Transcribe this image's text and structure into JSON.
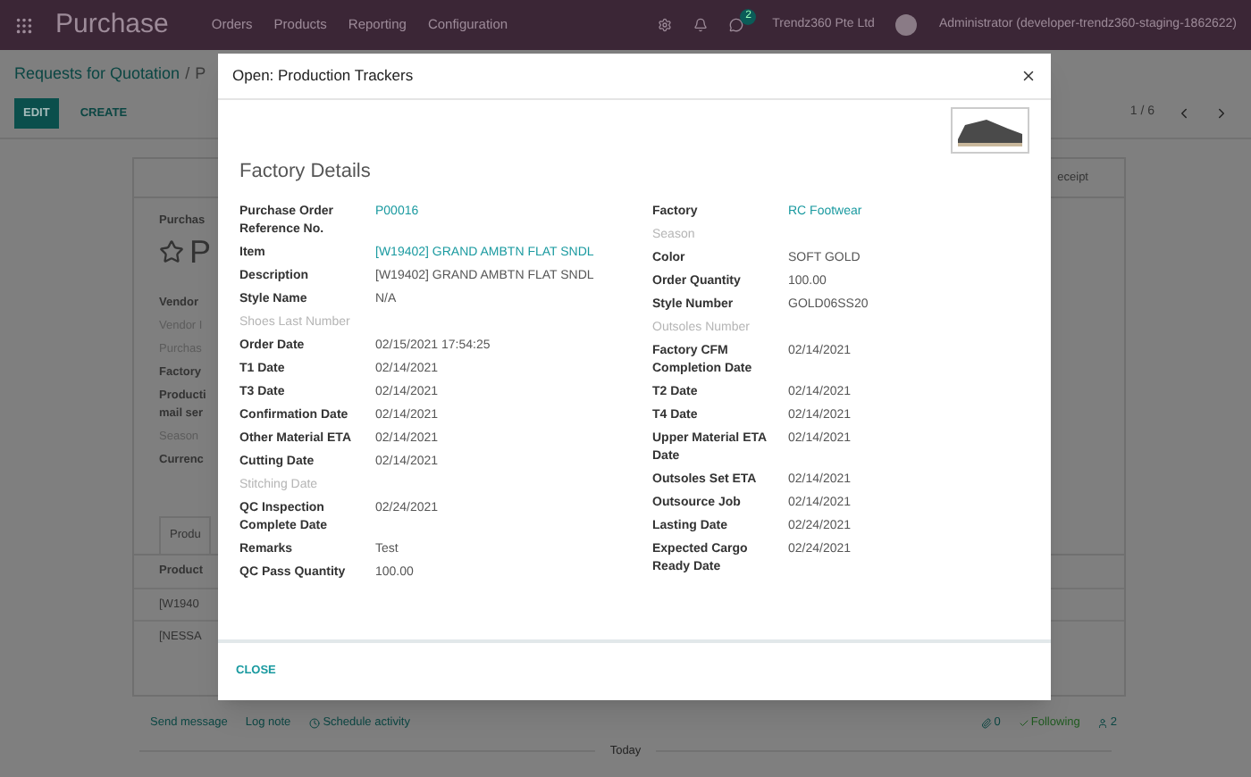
{
  "navbar": {
    "app_title": "Purchase",
    "menu": [
      "Orders",
      "Products",
      "Reporting",
      "Configuration"
    ],
    "chat_badge": "2",
    "company": "Trendz360 Pte Ltd",
    "user": "Administrator (developer-trendz360-staging-1862622)"
  },
  "breadcrumb": {
    "parent": "Requests for Quotation",
    "separator": "/",
    "current": "P"
  },
  "buttons": {
    "edit": "EDIT",
    "create": "CREATE"
  },
  "pager": "1 / 6",
  "sheet": {
    "heading": "Purchas",
    "title": "P",
    "starred": false,
    "fields": [
      {
        "label": "Vendor",
        "muted": false
      },
      {
        "label": "Vendor I",
        "muted": true
      },
      {
        "label": "Purchas",
        "muted": true
      },
      {
        "label": "Factory",
        "muted": false
      },
      {
        "label": "Producti\nmail ser",
        "muted": false
      },
      {
        "label": "Season",
        "muted": true
      },
      {
        "label": "Currenc",
        "muted": false
      }
    ],
    "tab": "Produ",
    "right_tab": "eceipt",
    "table_header": "Product",
    "table_rows": [
      "[W1940",
      "[NESSA"
    ]
  },
  "modal": {
    "title": "Open: Production Trackers",
    "section_title": "Factory Details",
    "left_fields": [
      {
        "label": "Purchase Order Reference No.",
        "value": "P00016",
        "kind": "link"
      },
      {
        "label": "Item",
        "value": "[W19402] GRAND AMBTN FLAT SNDL",
        "kind": "link"
      },
      {
        "label": "Description",
        "value": "[W19402] GRAND AMBTN FLAT SNDL",
        "kind": "text"
      },
      {
        "label": "Style Name",
        "value": "N/A",
        "kind": "text"
      },
      {
        "label": "Shoes Last Number",
        "kind": "empty"
      },
      {
        "label": "Order Date",
        "value": "02/15/2021 17:54:25",
        "kind": "text"
      },
      {
        "label": "T1 Date",
        "value": "02/14/2021",
        "kind": "text"
      },
      {
        "label": "T3 Date",
        "value": "02/14/2021",
        "kind": "text"
      },
      {
        "label": "Confirmation Date",
        "value": "02/14/2021",
        "kind": "text"
      },
      {
        "label": "Other Material ETA",
        "value": "02/14/2021",
        "kind": "text"
      },
      {
        "label": "Cutting Date",
        "value": "02/14/2021",
        "kind": "text"
      },
      {
        "label": "Stitching Date",
        "kind": "empty"
      },
      {
        "label": "QC Inspection Complete Date",
        "value": "02/24/2021",
        "kind": "text"
      },
      {
        "label": "Remarks",
        "value": "Test",
        "kind": "text"
      },
      {
        "label": "QC Pass Quantity",
        "value": "100.00",
        "kind": "text"
      }
    ],
    "right_fields": [
      {
        "label": "Factory",
        "value": "RC Footwear",
        "kind": "link"
      },
      {
        "label": "Season",
        "kind": "empty"
      },
      {
        "label": "Color",
        "value": "SOFT GOLD",
        "kind": "text"
      },
      {
        "label": "Order Quantity",
        "value": "100.00",
        "kind": "text"
      },
      {
        "label": "Style Number",
        "value": "GOLD06SS20",
        "kind": "text"
      },
      {
        "label": "Outsoles Number",
        "kind": "empty"
      },
      {
        "label": "Factory CFM Completion Date",
        "value": "02/14/2021",
        "kind": "text"
      },
      {
        "label": "T2 Date",
        "value": "02/14/2021",
        "kind": "text"
      },
      {
        "label": "T4 Date",
        "value": "02/14/2021",
        "kind": "text"
      },
      {
        "label": "Upper Material ETA Date",
        "value": "02/14/2021",
        "kind": "text"
      },
      {
        "label": "Outsoles Set ETA",
        "value": "02/14/2021",
        "kind": "text"
      },
      {
        "label": "Outsource Job",
        "value": "02/14/2021",
        "kind": "text"
      },
      {
        "label": "Lasting Date",
        "value": "02/24/2021",
        "kind": "text"
      },
      {
        "label": "Expected Cargo Ready Date",
        "value": "02/24/2021",
        "kind": "text"
      }
    ],
    "close": "CLOSE"
  },
  "chatter": {
    "send_message": "Send message",
    "log_note": "Log note",
    "schedule": "Schedule activity",
    "attachments": "0",
    "following": "Following",
    "followers": "2",
    "today": "Today"
  }
}
